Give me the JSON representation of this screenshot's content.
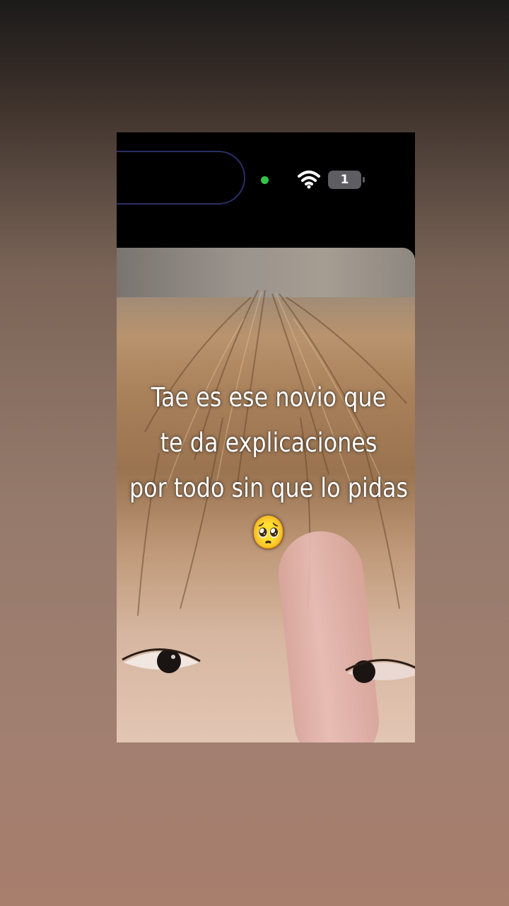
{
  "status_bar": {
    "battery_level_text": "1",
    "icons": [
      "dynamic-island",
      "camera-indicator-dot",
      "wifi-icon",
      "battery-icon"
    ],
    "colors": {
      "indicator": "#35c24a",
      "battery_badge": "#5e5e62",
      "island_border": "#2a2f66"
    }
  },
  "caption": {
    "line1": "Tae es ese novio que",
    "line2": "te da explicaciones",
    "line3": "por todo sin que lo pidas",
    "emoji": "🥺"
  }
}
